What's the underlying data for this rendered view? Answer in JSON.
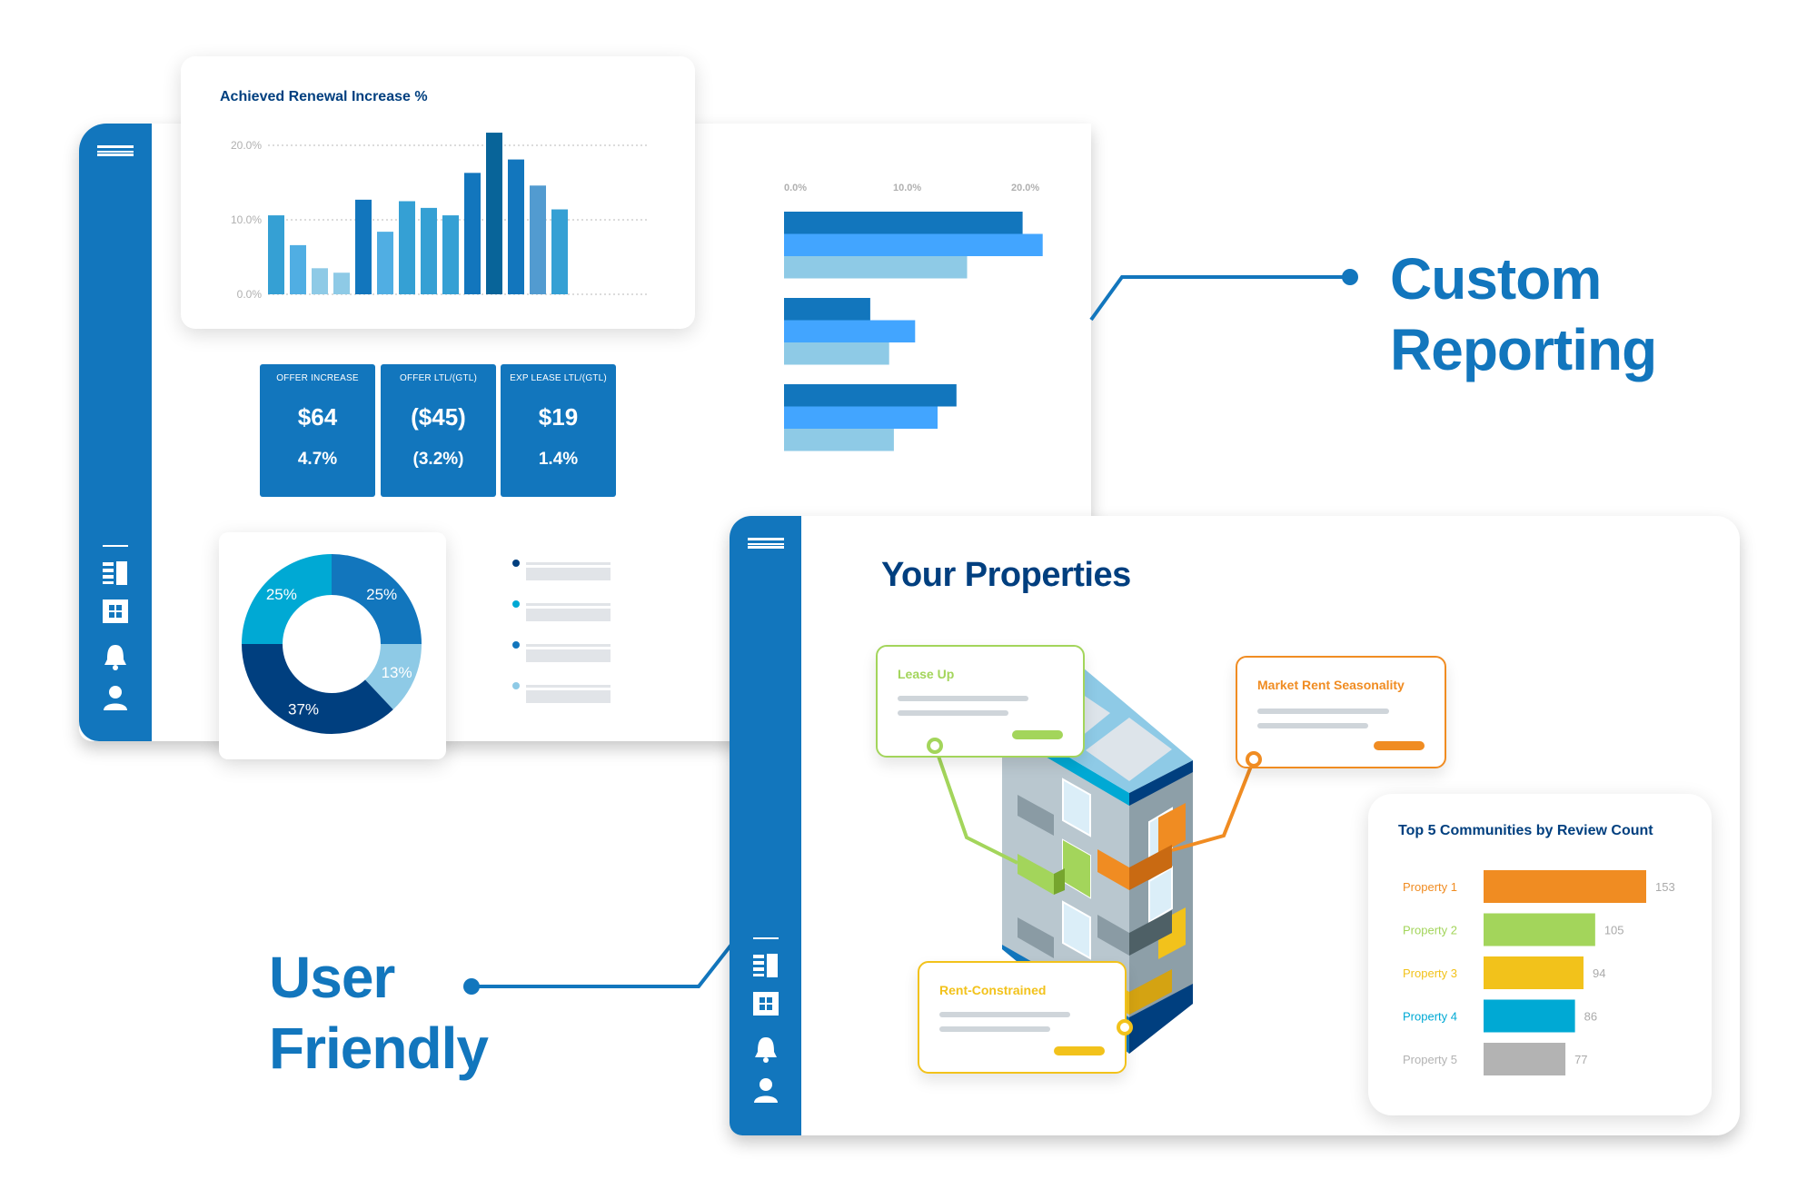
{
  "colors": {
    "brand": "#1276bd",
    "navy": "#003f7f",
    "green": "#a3d55b",
    "orange": "#f08c22",
    "yellow": "#f2c21b",
    "cyan": "#00a9d4",
    "gray": "#b3b3b3"
  },
  "sidebar_icons": [
    "menu-icon",
    "report-icon",
    "grid-icon",
    "bell-icon",
    "user-icon"
  ],
  "renewal_chart": {
    "type": "bar",
    "title": "Achieved Renewal Increase %",
    "yticks": [
      "0.0%",
      "10.0%",
      "20.0%"
    ],
    "ylim": [
      0,
      20
    ],
    "values": [
      10.6,
      6.6,
      3.5,
      2.9,
      12.7,
      8.4,
      12.5,
      11.6,
      10.6,
      16.3,
      21.7,
      18.1,
      14.6,
      11.4
    ],
    "bar_colors": [
      "#35a0d4",
      "#50aee3",
      "#8ecae6",
      "#8ecae6",
      "#1276bd",
      "#50aee3",
      "#35a0d4",
      "#35a0d4",
      "#35a0d4",
      "#1276bd",
      "#086499",
      "#1276bd",
      "#529bd0",
      "#35a0d4"
    ]
  },
  "kpis": [
    {
      "label": "OFFER INCREASE",
      "value": "$64",
      "pct": "4.7%"
    },
    {
      "label": "OFFER LTL/(GTL)",
      "value": "($45)",
      "pct": "(3.2%)"
    },
    {
      "label": "EXP LEASE LTL/(GTL)",
      "value": "$19",
      "pct": "1.4%"
    }
  ],
  "hbar_chart": {
    "type": "bar",
    "orientation": "horizontal",
    "xticks": [
      "0.0%",
      "10.0%",
      "20.0%"
    ],
    "xlim": [
      0,
      20
    ],
    "series_colors": [
      "#1276bd",
      "#42a5ff",
      "#8ecae6"
    ],
    "groups": [
      [
        20.2,
        21.9,
        15.5
      ],
      [
        7.3,
        11.1,
        8.9
      ],
      [
        14.6,
        13.0,
        9.3
      ]
    ]
  },
  "donut_chart": {
    "type": "pie",
    "slices": [
      {
        "label": "25%",
        "value": 25,
        "color": "#1276bd"
      },
      {
        "label": "13%",
        "value": 13,
        "color": "#8ecae6"
      },
      {
        "label": "37%",
        "value": 37,
        "color": "#003f7f"
      },
      {
        "label": "25%",
        "value": 25,
        "color": "#00a9d4"
      }
    ],
    "legend_dot_colors": [
      "#003f7f",
      "#00a9d4",
      "#1276bd",
      "#8ecae6"
    ]
  },
  "custom_reporting": {
    "line1": "Custom",
    "line2": "Reporting"
  },
  "user_friendly": {
    "line1": "User",
    "line2": "Friendly"
  },
  "properties": {
    "title": "Your Properties",
    "callouts": [
      {
        "title": "Lease Up",
        "color": "#a3d55b"
      },
      {
        "title": "Market Rent Seasonality",
        "color": "#f08c22"
      },
      {
        "title": "Rent-Constrained",
        "color": "#f2c21b"
      }
    ]
  },
  "top5_chart": {
    "type": "bar",
    "orientation": "horizontal",
    "title": "Top 5 Communities by Review Count",
    "categories": [
      "Property 1",
      "Property 2",
      "Property 3",
      "Property 4",
      "Property 5"
    ],
    "values": [
      153,
      105,
      94,
      86,
      77
    ],
    "colors": [
      "#f08c22",
      "#a3d55b",
      "#f2c21b",
      "#00a9d4",
      "#b3b3b3"
    ]
  }
}
